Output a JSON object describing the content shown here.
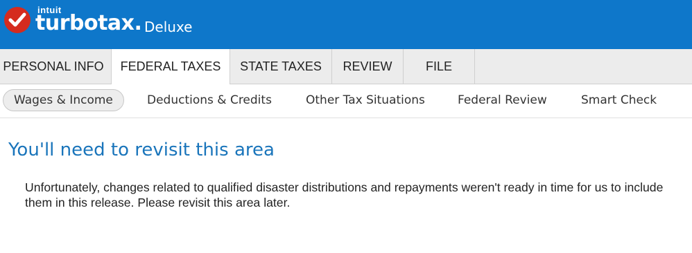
{
  "brand": {
    "company": "intuit",
    "product": "turbotax.",
    "edition": "Deluxe",
    "check_color": "#d52b1e"
  },
  "tabs": [
    {
      "label": "PERSONAL INFO",
      "active": false
    },
    {
      "label": "FEDERAL TAXES",
      "active": true
    },
    {
      "label": "STATE TAXES",
      "active": false
    },
    {
      "label": "REVIEW",
      "active": false
    },
    {
      "label": "FILE",
      "active": false
    }
  ],
  "subtabs": [
    {
      "label": "Wages & Income",
      "active": true
    },
    {
      "label": "Deductions & Credits",
      "active": false
    },
    {
      "label": "Other Tax Situations",
      "active": false
    },
    {
      "label": "Federal Review",
      "active": false
    },
    {
      "label": "Smart Check",
      "active": false
    }
  ],
  "main": {
    "title": "You'll need to revisit this area",
    "message": "Unfortunately, changes related to qualified disaster distributions and repayments weren't ready in time for us to include them in this release. Please revisit this area later."
  },
  "colors": {
    "header_bg": "#0e77ca",
    "title": "#1a75bb"
  }
}
